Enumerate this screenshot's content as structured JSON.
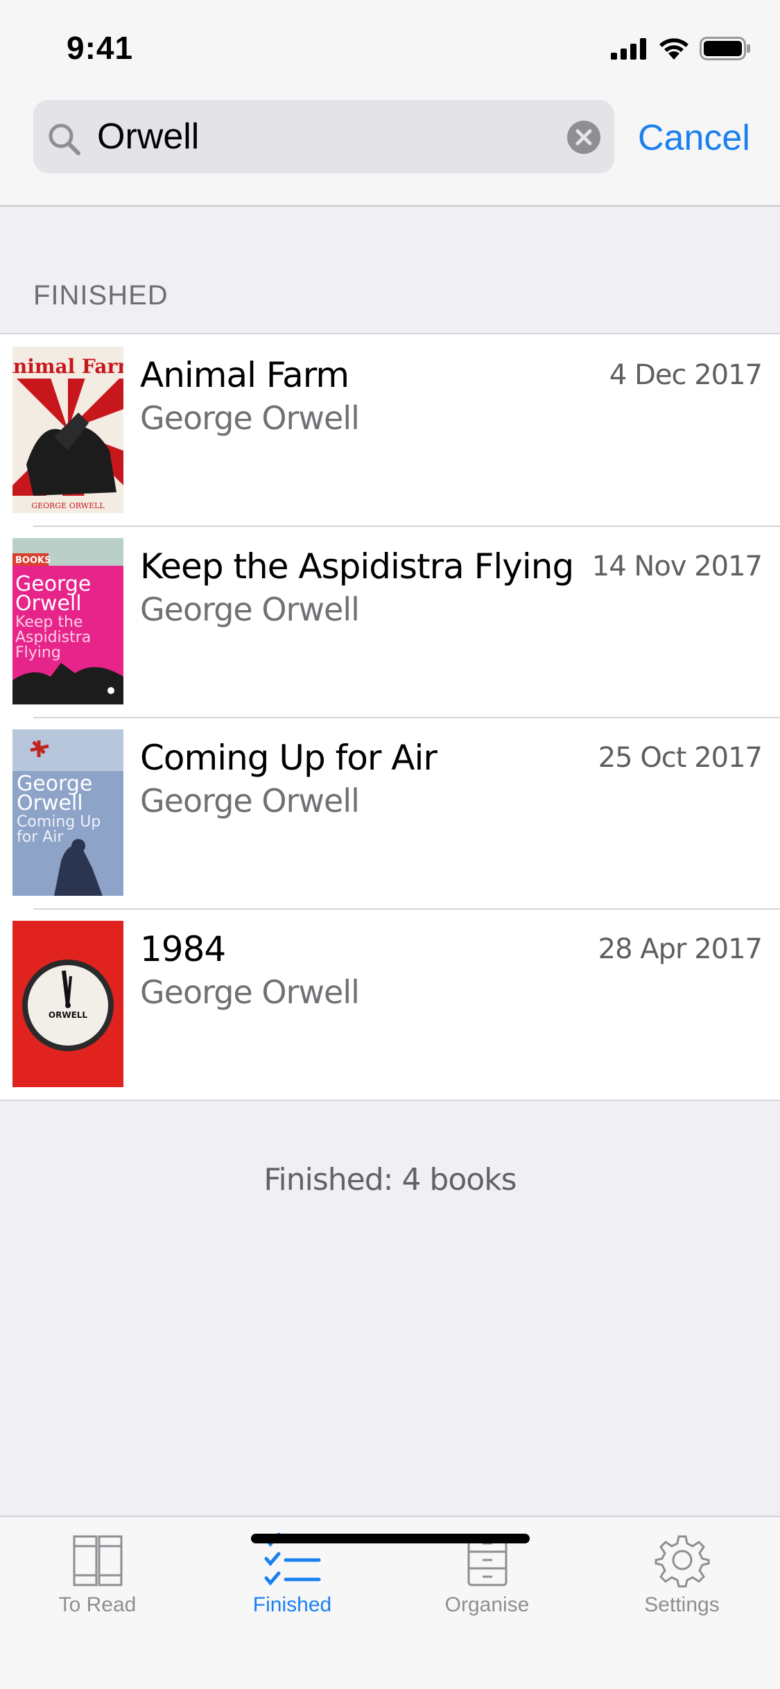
{
  "status_bar": {
    "time": "9:41"
  },
  "search": {
    "query": "Orwell",
    "cancel_label": "Cancel"
  },
  "section": {
    "header": "FINISHED"
  },
  "books": [
    {
      "title": "Animal Farm",
      "author": "George Orwell",
      "date": "4 Dec 2017"
    },
    {
      "title": "Keep the Aspidistra Flying",
      "author": "George Orwell",
      "date": "14 Nov 2017"
    },
    {
      "title": "Coming Up for Air",
      "author": "George Orwell",
      "date": "25 Oct 2017"
    },
    {
      "title": "1984",
      "author": "George Orwell",
      "date": "28 Apr 2017"
    }
  ],
  "covers": {
    "animal_farm": {
      "title": "Animal Farm",
      "author": "GEORGE ORWELL"
    },
    "aspidistra": {
      "tag": "BOOKS",
      "line1": "George",
      "line2": "Orwell",
      "line3": "Keep the",
      "line4": "Aspidistra",
      "line5": "Flying"
    },
    "coming_up": {
      "line1": "George",
      "line2": "Orwell",
      "line3": "Coming Up",
      "line4": "for Air"
    },
    "nineteen": {
      "clock_label": "ORWELL"
    }
  },
  "summary": "Finished: 4 books",
  "tabs": [
    {
      "label": "To Read",
      "icon": "books-icon",
      "active": false
    },
    {
      "label": "Finished",
      "icon": "checklist-icon",
      "active": true
    },
    {
      "label": "Organise",
      "icon": "cabinet-icon",
      "active": false
    },
    {
      "label": "Settings",
      "icon": "gear-icon",
      "active": false
    }
  ],
  "colors": {
    "accent": "#1a80f0",
    "inactive": "#8e8e93"
  }
}
